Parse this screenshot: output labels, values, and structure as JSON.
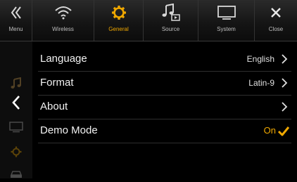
{
  "tabs": {
    "menu": "Menu",
    "wireless": "Wireless",
    "general": "General",
    "source": "Source",
    "system": "System",
    "close": "Close"
  },
  "active_tab": "General",
  "colors": {
    "accent": "#f0a800",
    "text": "#ffffff",
    "background": "#000000"
  },
  "sidebar_icons": [
    "music-icon",
    "back-arrow-icon",
    "display-icon",
    "gear-icon",
    "car-icon"
  ],
  "settings": [
    {
      "label": "Language",
      "value": "English"
    },
    {
      "label": "Format",
      "value": "Latin-9"
    },
    {
      "label": "About",
      "value": ""
    },
    {
      "label": "Demo Mode",
      "value": "On",
      "checked": true
    }
  ]
}
